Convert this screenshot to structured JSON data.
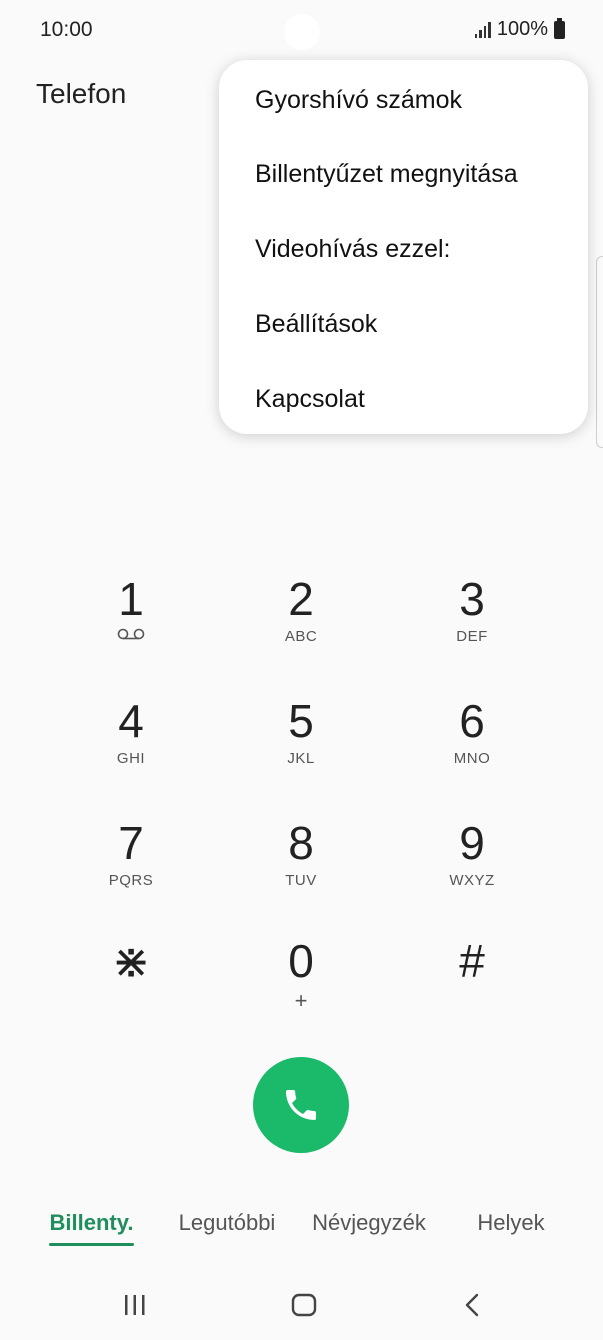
{
  "status": {
    "time": "10:00",
    "battery": "100%"
  },
  "app": {
    "title": "Telefon"
  },
  "menu": {
    "items": [
      {
        "label": "Gyorshívó számok"
      },
      {
        "label": "Billentyűzet megnyitása"
      },
      {
        "label": "Videohívás ezzel:"
      },
      {
        "label": "Beállítások"
      },
      {
        "label": "Kapcsolat"
      }
    ]
  },
  "keypad": {
    "keys": [
      {
        "digit": "1",
        "sub": ""
      },
      {
        "digit": "2",
        "sub": "ABC"
      },
      {
        "digit": "3",
        "sub": "DEF"
      },
      {
        "digit": "4",
        "sub": "GHI"
      },
      {
        "digit": "5",
        "sub": "JKL"
      },
      {
        "digit": "6",
        "sub": "MNO"
      },
      {
        "digit": "7",
        "sub": "PQRS"
      },
      {
        "digit": "8",
        "sub": "TUV"
      },
      {
        "digit": "9",
        "sub": "WXYZ"
      },
      {
        "digit": "⋇",
        "sub": ""
      },
      {
        "digit": "0",
        "sub": "+"
      },
      {
        "digit": "#",
        "sub": ""
      }
    ]
  },
  "tabs": [
    {
      "label": "Billenty.",
      "active": true
    },
    {
      "label": "Legutóbbi",
      "active": false
    },
    {
      "label": "Névjegyzék",
      "active": false
    },
    {
      "label": "Helyek",
      "active": false
    }
  ],
  "colors": {
    "accent": "#1e8f5c",
    "call": "#1bb96a"
  },
  "icons": {
    "signal": "signal-icon",
    "battery": "battery-icon",
    "voicemail": "voicemail-icon",
    "call": "phone-icon",
    "recents_nav": "recent-apps-icon",
    "home_nav": "home-icon",
    "back_nav": "back-icon"
  }
}
